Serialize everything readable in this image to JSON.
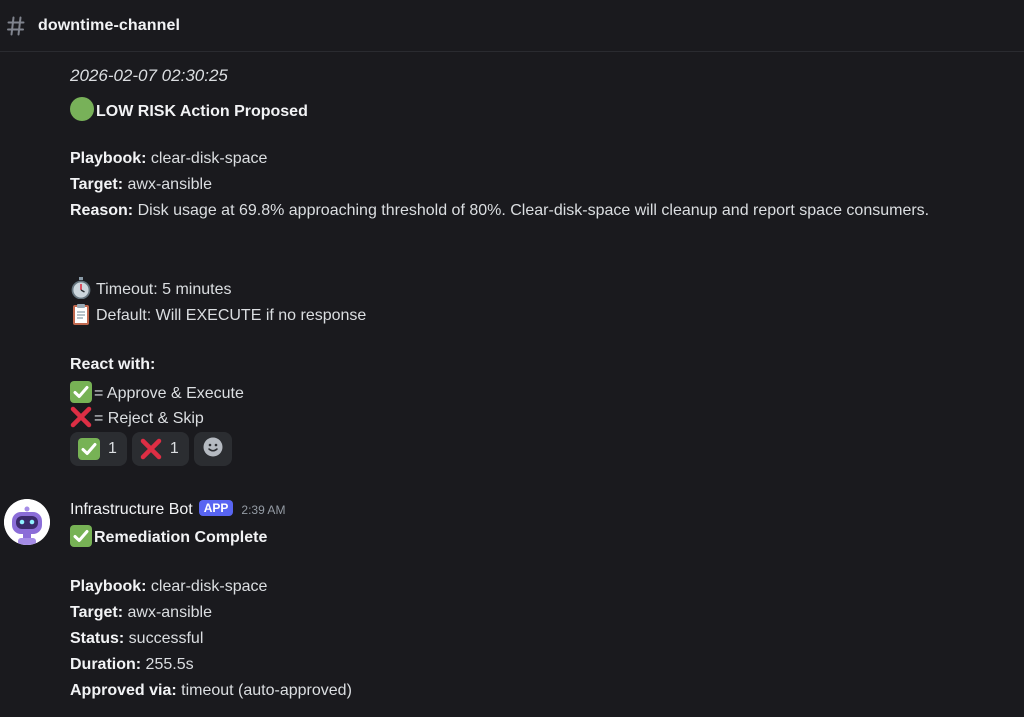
{
  "channel": {
    "name": "downtime-channel",
    "icon": "hash-icon"
  },
  "message1": {
    "timestamp": "2026-02-07 02:30:25",
    "title": "LOW RISK Action Proposed",
    "title_icon": "green-circle-icon",
    "playbook_label": "Playbook:",
    "playbook_value": " clear-disk-space",
    "target_label": "Target:",
    "target_value": " awx-ansible",
    "reason_label": "Reason:",
    "reason_value": " Disk usage at 69.8% approaching threshold of 80%. Clear-disk-space will cleanup and report space consumers.",
    "timeout_text": "Timeout: 5 minutes",
    "default_text": "Default: Will EXECUTE if no response",
    "react_heading": "React with:",
    "approve_text": "= Approve & Execute",
    "reject_text": "= Reject & Skip",
    "reactions": [
      {
        "icon": "check-mark-icon",
        "count": "1"
      },
      {
        "icon": "cross-mark-icon",
        "count": "1"
      }
    ]
  },
  "message2": {
    "author": "Infrastructure Bot",
    "badge": "APP",
    "time": "2:39 AM",
    "title": "Remediation Complete",
    "playbook_label": "Playbook:",
    "playbook_value": " clear-disk-space",
    "target_label": "Target:",
    "target_value": " awx-ansible",
    "status_label": "Status:",
    "status_value": " successful",
    "duration_label": "Duration:",
    "duration_value": " 255.5s",
    "approved_label": "Approved via:",
    "approved_value": " timeout (auto-approved)"
  },
  "colors": {
    "background": "#1a1a1e",
    "text": "#dbdee1",
    "accent": "#5865f2",
    "success_green": "#3ba55c",
    "reject_red": "#dd2e44"
  }
}
